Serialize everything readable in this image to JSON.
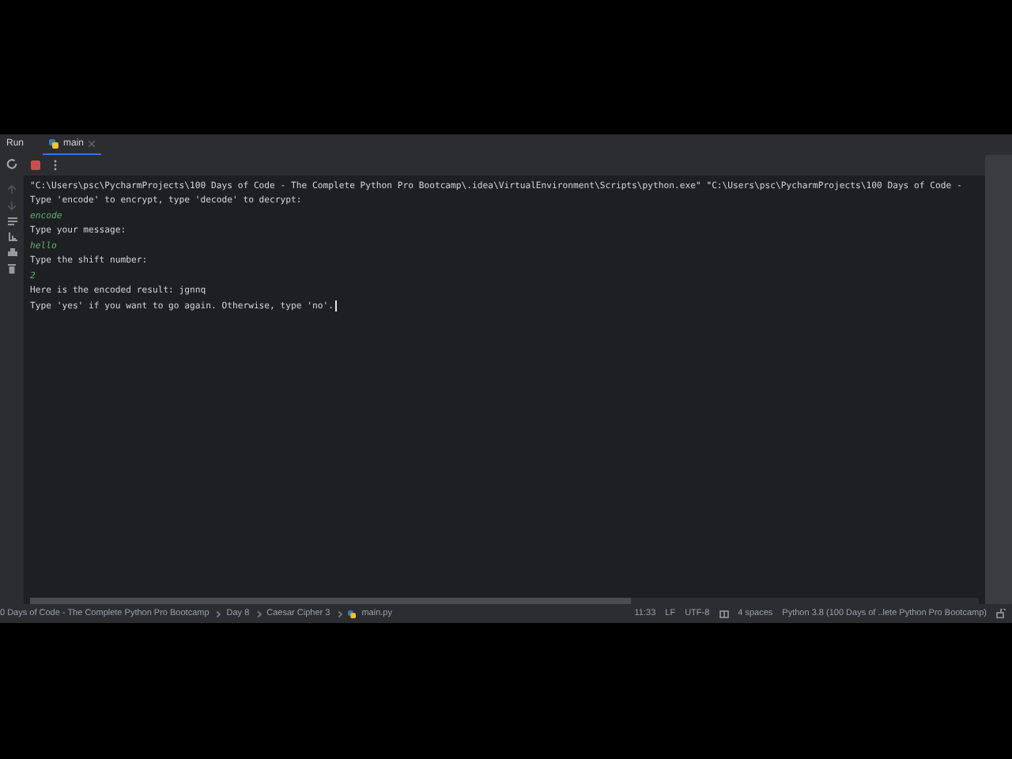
{
  "tool_window": {
    "title": "Run",
    "tabs": [
      {
        "label": "main",
        "selected": true
      }
    ]
  },
  "console": {
    "lines": [
      {
        "kind": "output",
        "text": "\"C:\\Users\\psc\\PycharmProjects\\100 Days of Code - The Complete Python Pro Bootcamp\\.idea\\VirtualEnvironment\\Scripts\\python.exe\" \"C:\\Users\\psc\\PycharmProjects\\100 Days of Code -"
      },
      {
        "kind": "output",
        "text": "Type 'encode' to encrypt, type 'decode' to decrypt:"
      },
      {
        "kind": "input",
        "text": "encode"
      },
      {
        "kind": "output",
        "text": "Type your message:"
      },
      {
        "kind": "input",
        "text": "hello"
      },
      {
        "kind": "output",
        "text": "Type the shift number:"
      },
      {
        "kind": "input",
        "text": "2"
      },
      {
        "kind": "output",
        "text": "Here is the encoded result: jgnnq"
      },
      {
        "kind": "output",
        "text": "Type 'yes' if you want to go again. Otherwise, type 'no'.",
        "caret": true
      }
    ]
  },
  "status_bar": {
    "breadcrumbs": [
      "0 Days of Code - The Complete Python Pro Bootcamp",
      "Day 8",
      "Caesar Cipher 3",
      "main.py"
    ],
    "items": [
      "11:33",
      "LF",
      "UTF-8",
      "4 spaces",
      "Python 3.8 (100 Days of ..lete Python Pro Bootcamp)"
    ]
  }
}
